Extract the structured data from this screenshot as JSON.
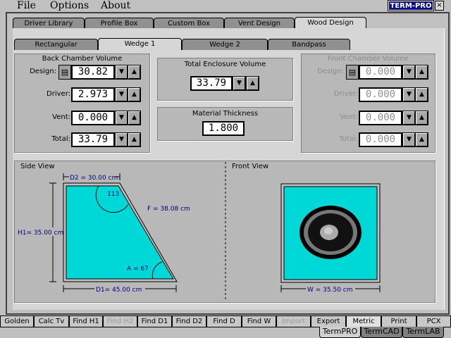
{
  "menu": {
    "file": "File",
    "options": "Options",
    "about": "About"
  },
  "logo": "TERM-PRO",
  "close": "×",
  "tabs": [
    "Driver Library",
    "Profile Box",
    "Custom Box",
    "Vent Design",
    "Wood Design"
  ],
  "subtabs": [
    "Rectangular",
    "Wedge 1",
    "Wedge 2",
    "Bandpass"
  ],
  "back": {
    "title": "Back Chamber Volume",
    "rows": [
      {
        "label": "Design:",
        "value": "30.82"
      },
      {
        "label": "Driver:",
        "value": "2.973"
      },
      {
        "label": "Vent:",
        "value": "0.000"
      },
      {
        "label": "Total:",
        "value": "33.79"
      }
    ]
  },
  "front": {
    "title": "Front Chamber Volume",
    "rows": [
      {
        "label": "Design:",
        "value": "0.000"
      },
      {
        "label": "Driver:",
        "value": "0.000"
      },
      {
        "label": "Vent:",
        "value": "0.000"
      },
      {
        "label": "Total:",
        "value": "0.000"
      }
    ]
  },
  "total": {
    "title": "Total Enclosure Volume",
    "value": "33.79"
  },
  "material": {
    "title": "Material Thickness",
    "value": "1.800"
  },
  "side": {
    "title": "Side View",
    "d2": "D2 = 30.00 cm",
    "h1": "H1= 35.00 cm",
    "f": "F = 38.08 cm",
    "angle_top": "113",
    "angle_a": "A = 67",
    "d1": "D1= 45.00 cm"
  },
  "frontview": {
    "title": "Front View",
    "w": "W = 35.50 cm"
  },
  "buttons": [
    "Golden",
    "Calc Tv",
    "Find H1",
    "Find H2",
    "Find D1",
    "Find D2",
    "Find D",
    "Find W",
    "Import",
    "Export",
    "Metric",
    "Print",
    "PCX"
  ],
  "bottom_tabs": [
    "TermPRO",
    "TermCAD",
    "TermLAB"
  ],
  "colors": {
    "box": "#00d8d8",
    "label": "#000080",
    "logo": "#101080"
  }
}
